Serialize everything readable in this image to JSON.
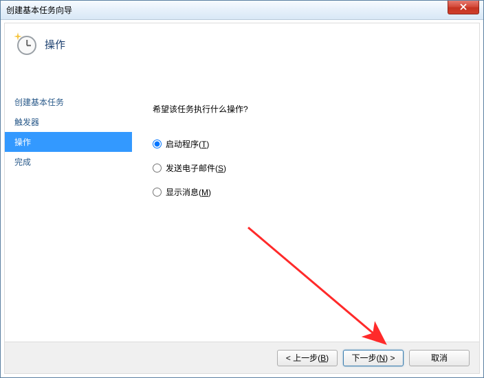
{
  "window": {
    "title": "创建基本任务向导"
  },
  "header": {
    "title": "操作"
  },
  "sidebar": {
    "steps": [
      {
        "label": "创建基本任务",
        "active": false
      },
      {
        "label": "触发器",
        "active": false
      },
      {
        "label": "操作",
        "active": true
      },
      {
        "label": "完成",
        "active": false
      }
    ]
  },
  "main": {
    "prompt": "希望该任务执行什么操作?",
    "options": [
      {
        "label_prefix": "启动程序(",
        "accel": "T",
        "label_suffix": ")",
        "checked": true
      },
      {
        "label_prefix": "发送电子邮件(",
        "accel": "S",
        "label_suffix": ")",
        "checked": false
      },
      {
        "label_prefix": "显示消息(",
        "accel": "M",
        "label_suffix": ")",
        "checked": false
      }
    ]
  },
  "footer": {
    "back": {
      "prefix": "< 上一步(",
      "accel": "B",
      "suffix": ")"
    },
    "next": {
      "prefix": "下一步(",
      "accel": "N",
      "suffix": ") >"
    },
    "cancel": "取消"
  }
}
